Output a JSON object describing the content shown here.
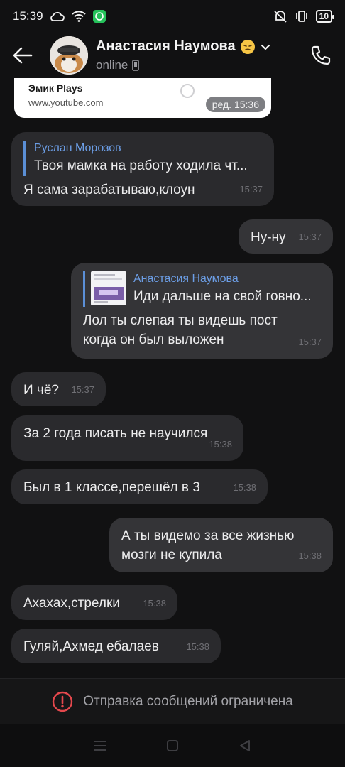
{
  "status_bar": {
    "time": "15:39",
    "battery": "10"
  },
  "header": {
    "contact_name": "Анастасия Наумова",
    "status": "online"
  },
  "link_preview": {
    "title": "Эмик Plays",
    "url": "www.youtube.com",
    "edited_time": "ред. 15:36"
  },
  "messages": [
    {
      "direction": "incoming",
      "reply_author": "Руслан Морозов",
      "reply_text": "Твоя мамка на работу ходила чт...",
      "text": "Я сама зарабатываю,клоун",
      "time": "15:37"
    },
    {
      "direction": "outgoing",
      "text": "Ну-ну",
      "time": "15:37"
    },
    {
      "direction": "outgoing",
      "reply_author": "Анастасия Наумова",
      "reply_text": "Иди дальше на свой говно...",
      "text_line1": "Лол ты слепая ты видешь пост",
      "text_line2": "когда он был выложен",
      "time": "15:37"
    },
    {
      "direction": "incoming",
      "text": "И чё?",
      "time": "15:37"
    },
    {
      "direction": "incoming",
      "text": "За 2 года писать не научился",
      "time": "15:38"
    },
    {
      "direction": "incoming",
      "text": "Был в 1 классе,перешёл в 3",
      "time": "15:38"
    },
    {
      "direction": "outgoing",
      "text_line1": "А ты видемо за все жизнью",
      "text_line2": "мозги не купила",
      "time": "15:38"
    },
    {
      "direction": "incoming",
      "text": "Ахахах,стрелки",
      "time": "15:38"
    },
    {
      "direction": "incoming",
      "text": "Гуляй,Ахмед ебалаев",
      "time": "15:38"
    }
  ],
  "restriction": {
    "text": "Отправка сообщений ограничена",
    "icon": "alert-circle-icon",
    "icon_color": "#e5484d"
  },
  "icons": {
    "back": "back-arrow-icon",
    "call": "phone-icon",
    "chevron": "chevron-down-icon",
    "device": "phone-device-icon"
  },
  "colors": {
    "background": "#111112",
    "incoming_bubble": "#2a2a2d",
    "outgoing_bubble": "#343437",
    "accent_blue": "#6c9ee6"
  }
}
